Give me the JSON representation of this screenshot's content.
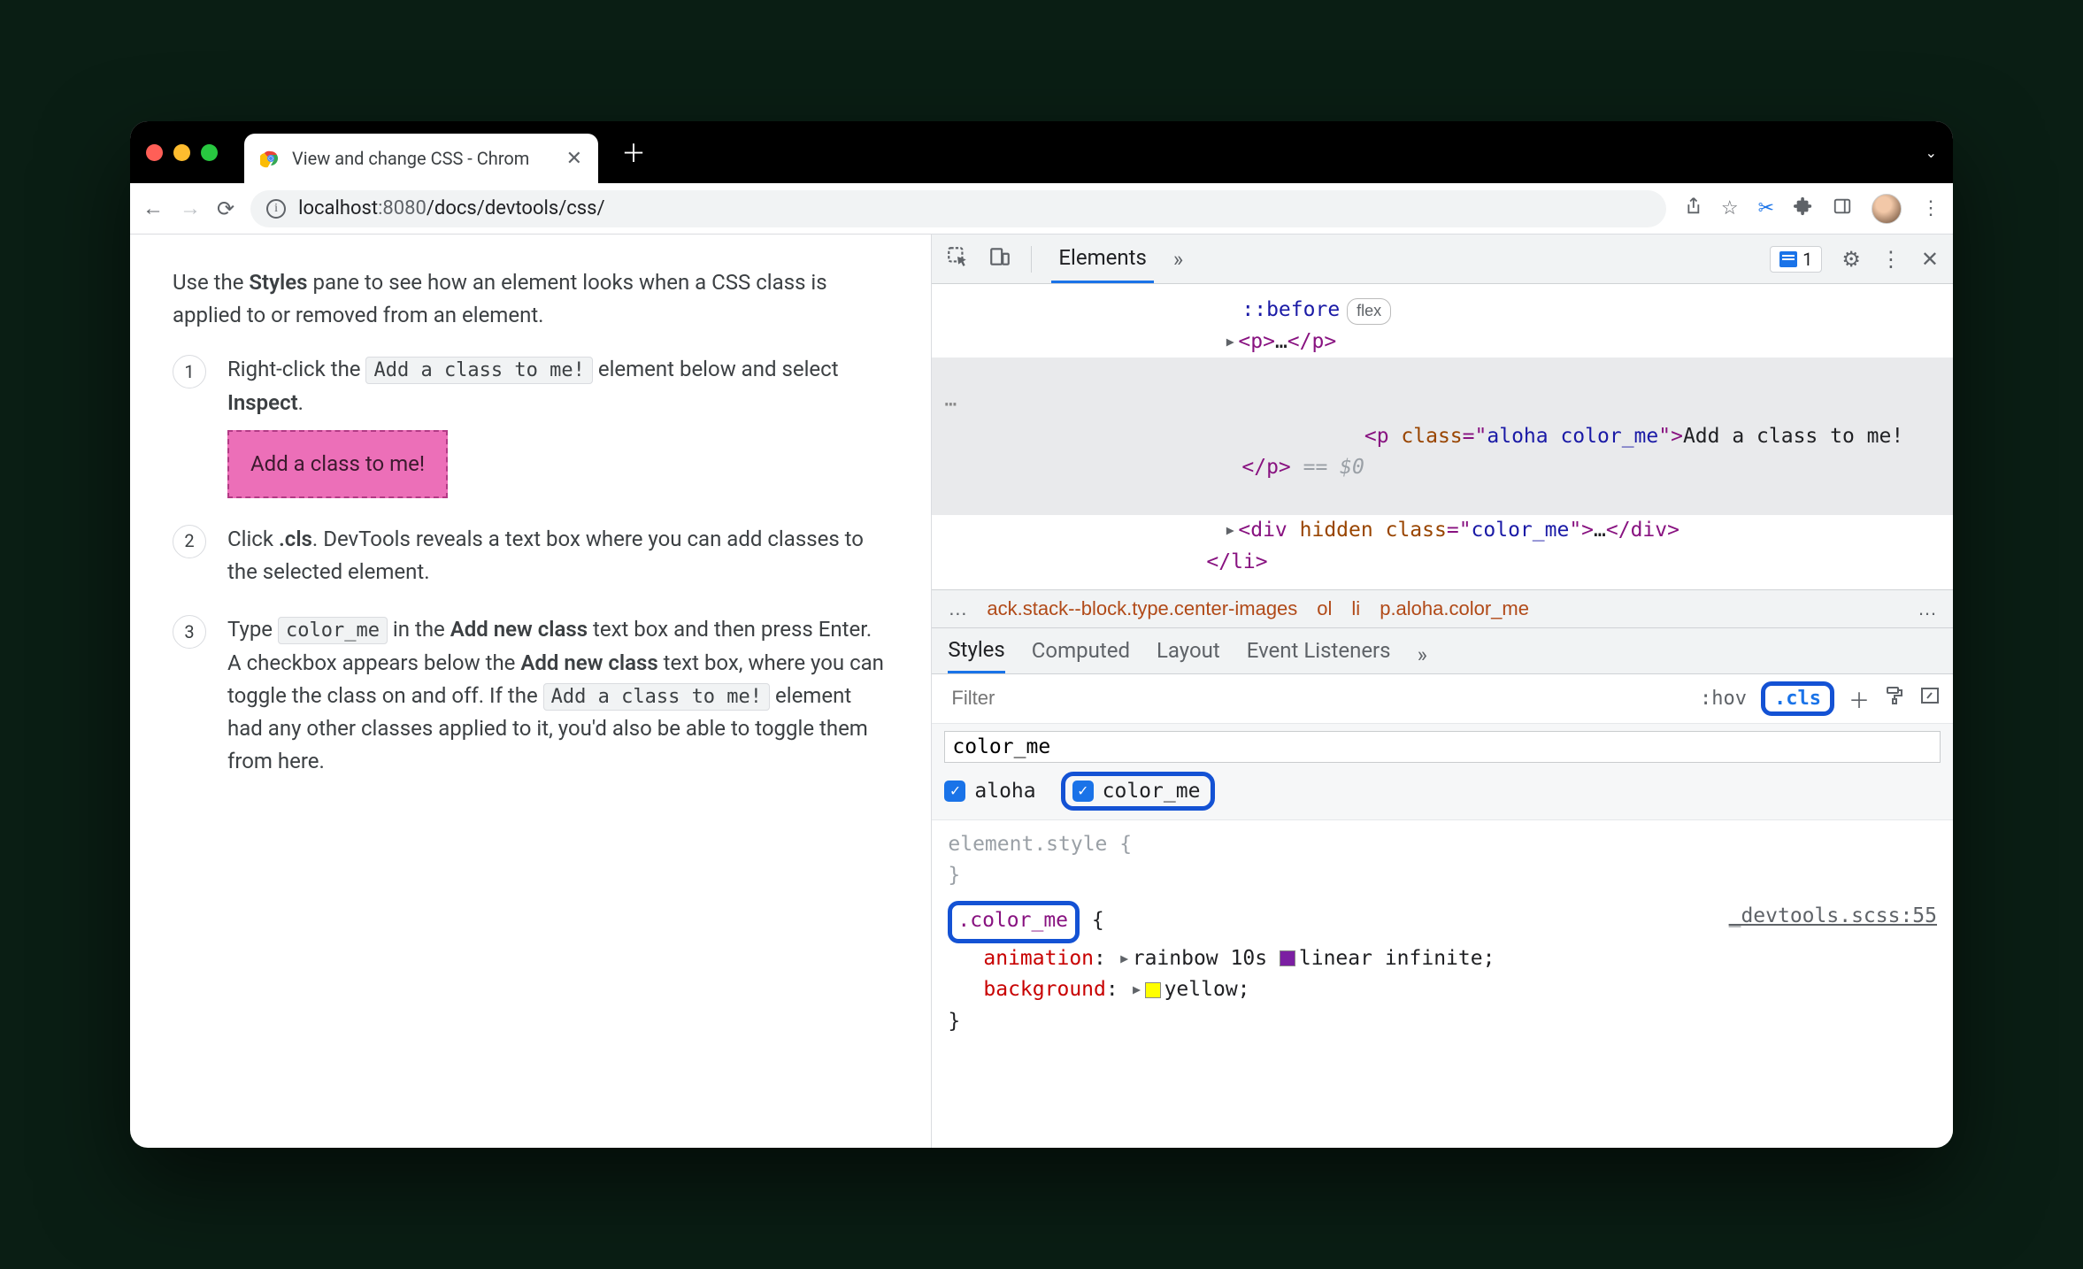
{
  "browser": {
    "tab_title": "View and change CSS - Chrom",
    "url_host": "localhost",
    "url_port": ":8080",
    "url_path": "/docs/devtools/css/",
    "issue_count": "1"
  },
  "page": {
    "intro_pre": "Use the ",
    "intro_bold": "Styles",
    "intro_post": " pane to see how an element looks when a CSS class is applied to or removed from an element.",
    "step1_pre": "Right-click the ",
    "step1_code": "Add a class to me!",
    "step1_mid": " element below and select ",
    "step1_bold": "Inspect",
    "pink_label": "Add a class to me!",
    "step2_pre": "Click ",
    "step2_bold": ".cls",
    "step2_post": ". DevTools reveals a text box where you can add classes to the selected element.",
    "step3_pre": "Type ",
    "step3_code1": "color_me",
    "step3_mid1": " in the ",
    "step3_bold1": "Add new class",
    "step3_mid2": " text box and then press Enter. A checkbox appears below the ",
    "step3_bold2": "Add new class",
    "step3_mid3": " text box, where you can toggle the class on and off. If the ",
    "step3_code2": "Add a class to me!",
    "step3_post": " element had any other classes applied to it, you'd also be able to toggle them from here."
  },
  "devtools": {
    "elements_tab": "Elements",
    "dom": {
      "before": "::before",
      "before_badge": "flex",
      "p_collapsed_open": "<p>",
      "p_collapsed_ell": "…",
      "p_collapsed_close": "</p>",
      "sel_open1": "<p ",
      "sel_attr_n": "class",
      "sel_attr_eq": "=\"",
      "sel_attr_v": "aloha color_me",
      "sel_open2": "\">",
      "sel_text": "Add a class to me!",
      "sel_close": "</p>",
      "sel_eq0": " == $0",
      "div_open1": "<div ",
      "div_attr1_n": "hidden",
      "div_attr2_n": "class",
      "div_attr2_eq": "=\"",
      "div_attr2_v": "color_me",
      "div_open2": "\">",
      "div_ell": "…",
      "div_close": "</div>",
      "li_close": "</li>"
    },
    "crumbs": {
      "ellipsis": "…",
      "c1": "ack.stack--block.type.center-images",
      "c2": "ol",
      "c3": "li",
      "c4": "p.aloha.color_me",
      "end": "…"
    },
    "styles_tabs": {
      "styles": "Styles",
      "computed": "Computed",
      "layout": "Layout",
      "event": "Event Listeners"
    },
    "filter_placeholder": "Filter",
    "hov": ":hov",
    "cls": ".cls",
    "class_input_value": "color_me",
    "checks": {
      "aloha": "aloha",
      "color_me": "color_me"
    },
    "rules": {
      "element_style": "element.style {",
      "close": "}",
      "color_me_selector": ".color_me",
      "src": "_devtools.scss:55",
      "anim_prop": "animation",
      "anim_val_pre": "rainbow 10s ",
      "anim_val_post": "linear infinite;",
      "bg_prop": "background",
      "bg_val": "yellow;"
    }
  }
}
